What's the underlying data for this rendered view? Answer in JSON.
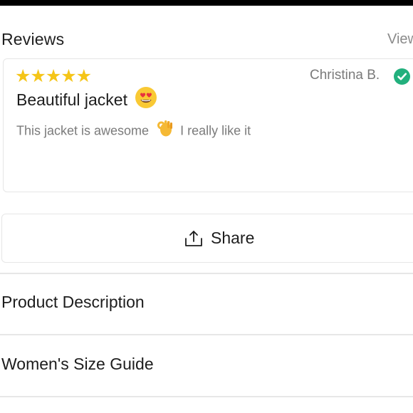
{
  "reviews": {
    "title": "Reviews",
    "view_all_label": "View",
    "items": [
      {
        "rating": 5,
        "stars": "★★★★★",
        "reviewer": "Christina B.",
        "verified": true,
        "title": "Beautiful jacket",
        "title_emoji": "heart-eyes-emoji",
        "body_part1": "This jacket is awesome",
        "body_emoji": "ok-hand-emoji",
        "body_part2": "I really like it"
      }
    ]
  },
  "share": {
    "label": "Share",
    "icon": "share-icon"
  },
  "accordion": [
    {
      "label": "Product Description"
    },
    {
      "label": "Women's Size Guide"
    }
  ],
  "colors": {
    "star": "#f5c518",
    "verified": "#22b07d",
    "muted_text": "#7b7b7b",
    "border": "#e6e6e6"
  }
}
